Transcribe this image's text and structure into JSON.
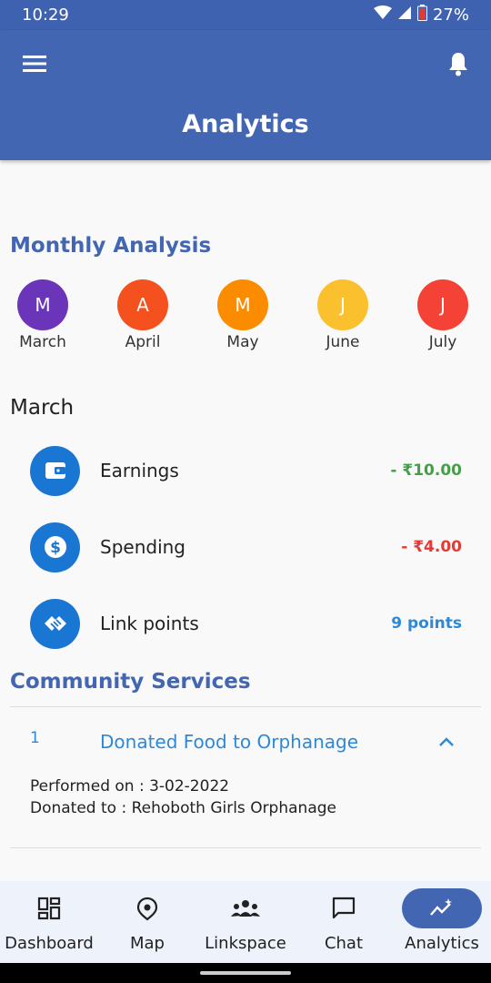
{
  "status_bar": {
    "time": "10:29",
    "battery": "27%"
  },
  "app_bar": {
    "title": "Analytics"
  },
  "monthly_analysis": {
    "title": "Monthly Analysis",
    "months": [
      {
        "initial": "M",
        "label": "March",
        "color": "#6a35b8"
      },
      {
        "initial": "A",
        "label": "April",
        "color": "#f4511e"
      },
      {
        "initial": "M",
        "label": "May",
        "color": "#fb8c00"
      },
      {
        "initial": "J",
        "label": "June",
        "color": "#fbc02d"
      },
      {
        "initial": "J",
        "label": "July",
        "color": "#f44336"
      }
    ]
  },
  "selected_month": "March",
  "metrics": [
    {
      "name": "Earnings",
      "value": "- ₹10.00",
      "icon": "wallet-icon",
      "color": "#43a047"
    },
    {
      "name": "Spending",
      "value": "- ₹4.00",
      "icon": "dollar-coin-icon",
      "color": "#e53935"
    },
    {
      "name": "Link points",
      "value": "9 points",
      "icon": "handshake-icon",
      "color": "#2d89d8"
    }
  ],
  "community_services": {
    "title": "Community Services",
    "items": [
      {
        "number": "1",
        "title": "Donated Food to Orphanage",
        "performed_on": "Performed on : 3-02-2022",
        "donated_to": "Donated to : Rehoboth Girls Orphanage"
      }
    ]
  },
  "bottom_nav": {
    "items": [
      {
        "label": "Dashboard",
        "icon": "dashboard-icon"
      },
      {
        "label": "Map",
        "icon": "map-pin-icon"
      },
      {
        "label": "Linkspace",
        "icon": "people-group-icon"
      },
      {
        "label": "Chat",
        "icon": "chat-bubble-icon"
      },
      {
        "label": "Analytics",
        "icon": "analytics-icon",
        "active": true
      }
    ]
  },
  "colors": {
    "primary": "#4266b2",
    "accent": "#2d89d8",
    "icon_bg": "#1976d2"
  }
}
